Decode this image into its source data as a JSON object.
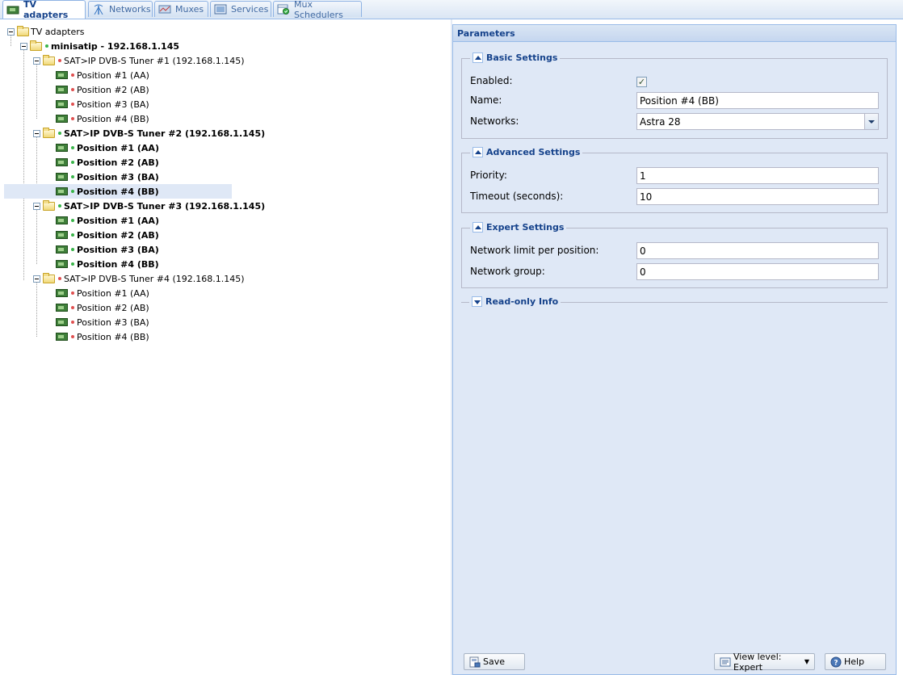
{
  "tabs": [
    {
      "label": "TV adapters",
      "icon": "tv-adapter-icon",
      "active": true
    },
    {
      "label": "Networks",
      "icon": "antenna-icon",
      "active": false
    },
    {
      "label": "Muxes",
      "icon": "muxes-icon",
      "active": false
    },
    {
      "label": "Services",
      "icon": "services-icon",
      "active": false
    },
    {
      "label": "Mux Schedulers",
      "icon": "scheduler-icon",
      "active": false
    }
  ],
  "tree": {
    "root": "TV adapters",
    "device": "minisatip - 192.168.1.145",
    "tuners": [
      {
        "label": "SAT>IP DVB-S Tuner #1 (192.168.1.145)",
        "status": "red",
        "positions": [
          "Position #1 (AA)",
          "Position #2 (AB)",
          "Position #3 (BA)",
          "Position #4 (BB)"
        ]
      },
      {
        "label": "SAT>IP DVB-S Tuner #2 (192.168.1.145)",
        "status": "green",
        "positions": [
          "Position #1 (AA)",
          "Position #2 (AB)",
          "Position #3 (BA)",
          "Position #4 (BB)"
        ]
      },
      {
        "label": "SAT>IP DVB-S Tuner #3 (192.168.1.145)",
        "status": "green",
        "positions": [
          "Position #1 (AA)",
          "Position #2 (AB)",
          "Position #3 (BA)",
          "Position #4 (BB)"
        ]
      },
      {
        "label": "SAT>IP DVB-S Tuner #4 (192.168.1.145)",
        "status": "red",
        "positions": [
          "Position #1 (AA)",
          "Position #2 (AB)",
          "Position #3 (BA)",
          "Position #4 (BB)"
        ]
      }
    ]
  },
  "params": {
    "title": "Parameters",
    "basic": {
      "legend": "Basic Settings",
      "enabled_label": "Enabled:",
      "enabled": true,
      "name_label": "Name:",
      "name_value": "Position #4 (BB)",
      "networks_label": "Networks:",
      "networks_value": "Astra 28"
    },
    "advanced": {
      "legend": "Advanced Settings",
      "priority_label": "Priority:",
      "priority_value": "1",
      "timeout_label": "Timeout (seconds):",
      "timeout_value": "10"
    },
    "expert": {
      "legend": "Expert Settings",
      "netlimit_label": "Network limit per position:",
      "netlimit_value": "0",
      "netgroup_label": "Network group:",
      "netgroup_value": "0"
    },
    "readonly": {
      "legend": "Read-only Info"
    }
  },
  "footer": {
    "save": "Save",
    "view_level": "View level: Expert",
    "help": "Help"
  },
  "colors": {
    "accent": "#15428b",
    "panel": "#dfe8f6",
    "border": "#99bbe8",
    "on": "#3ab54a",
    "off": "#e05050"
  }
}
